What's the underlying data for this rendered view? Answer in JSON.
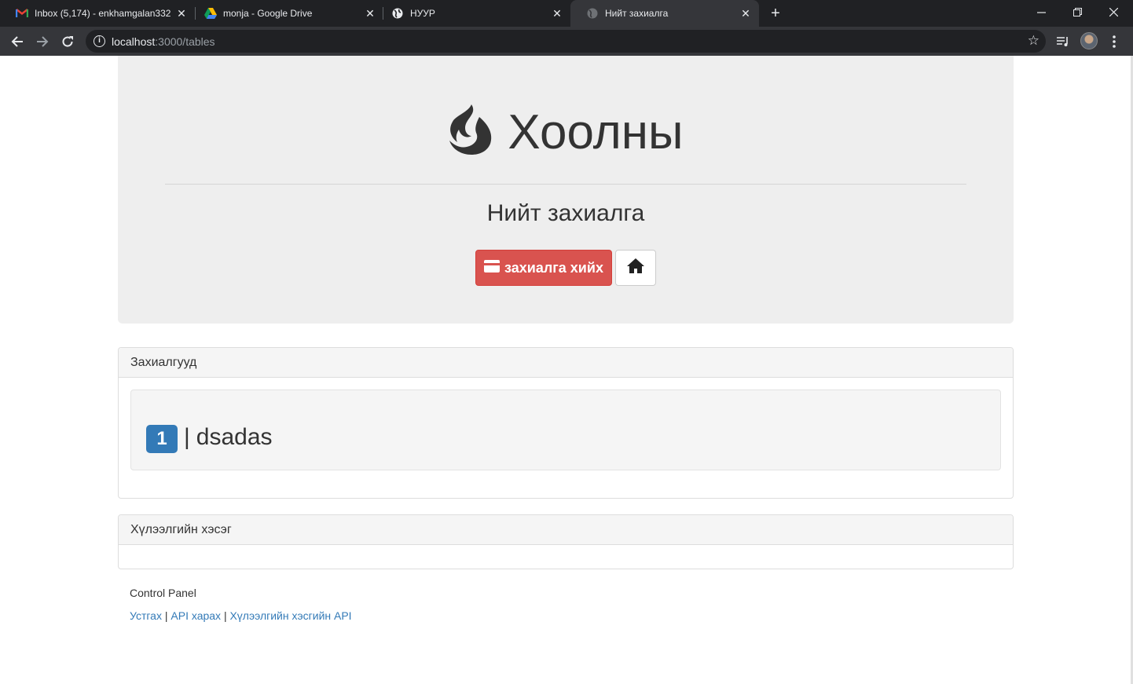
{
  "browser": {
    "tabs": [
      {
        "title": "Inbox (5,174) - enkhamgalan332",
        "icon": "gmail-icon"
      },
      {
        "title": "monja - Google Drive",
        "icon": "google-drive-icon"
      },
      {
        "title": "НУУР",
        "icon": "globe-icon"
      },
      {
        "title": "Нийт захиалга",
        "icon": "globe-icon"
      }
    ],
    "url_host": "localhost",
    "url_path": ":3000/tables"
  },
  "header": {
    "brand": "Хоолны",
    "subtitle": "Нийт захиалга",
    "order_button_label": "захиалга хийх"
  },
  "orders_panel": {
    "title": "Захиалгууд",
    "items": [
      {
        "number": "1",
        "separator": "|",
        "name": "dsadas"
      }
    ]
  },
  "kitchen_panel": {
    "title": "Хүлээлгийн хэсэг"
  },
  "footer": {
    "title": "Control Panel",
    "links": [
      "Устгах",
      "API харах",
      "Хүлээлгийн хэсгийн API"
    ],
    "separator": "|"
  },
  "colors": {
    "danger": "#d9534f",
    "primary": "#337ab7",
    "jumbotron": "#eeeeee"
  }
}
